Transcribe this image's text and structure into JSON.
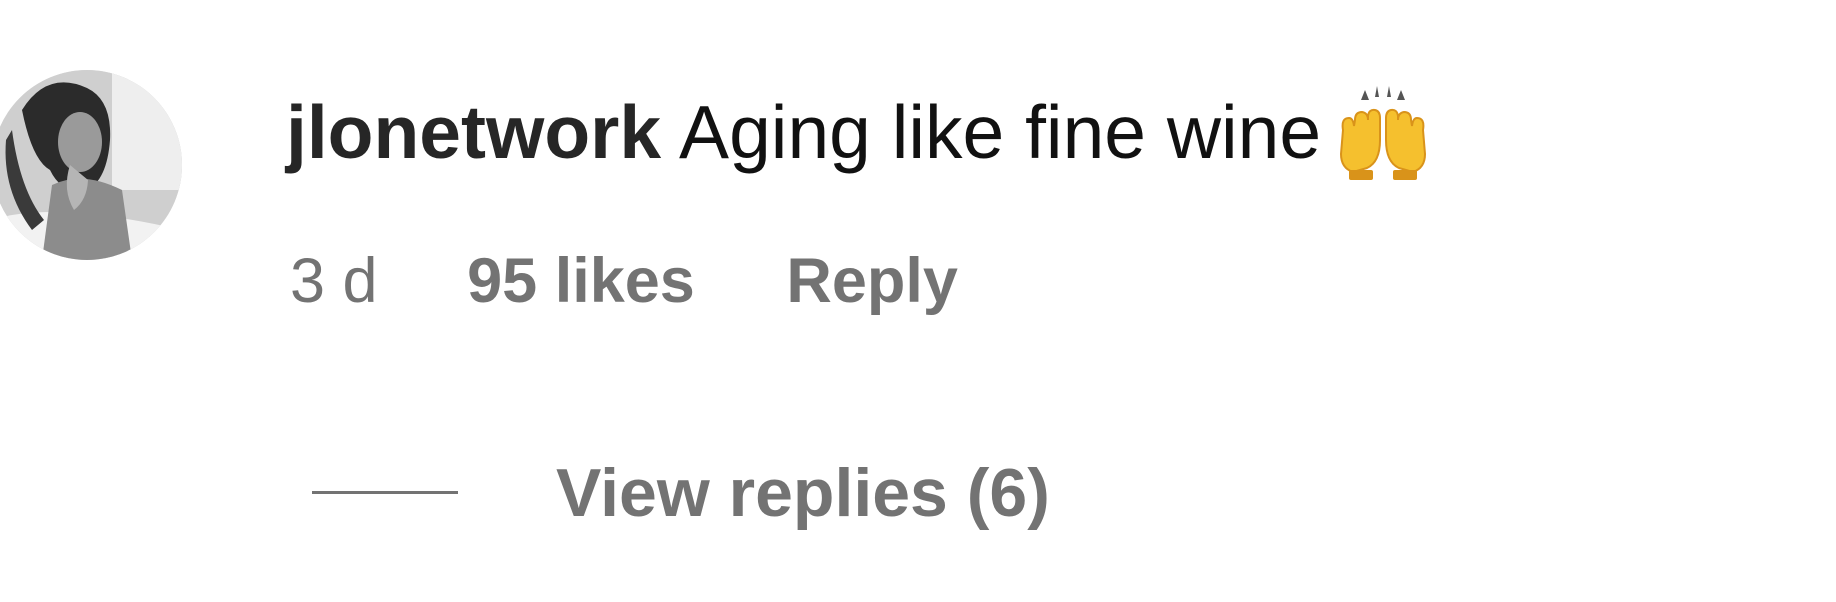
{
  "comment": {
    "username": "jlonetwork",
    "text": "Aging like fine wine",
    "emoji": "raising-hands-icon",
    "timestamp": "3 d",
    "likes": "95 likes",
    "reply_label": "Reply"
  },
  "replies": {
    "label": "View replies (6)"
  },
  "colors": {
    "username": "#262626",
    "text": "#111111",
    "secondary": "#737373",
    "emoji": "#F5C02E"
  }
}
